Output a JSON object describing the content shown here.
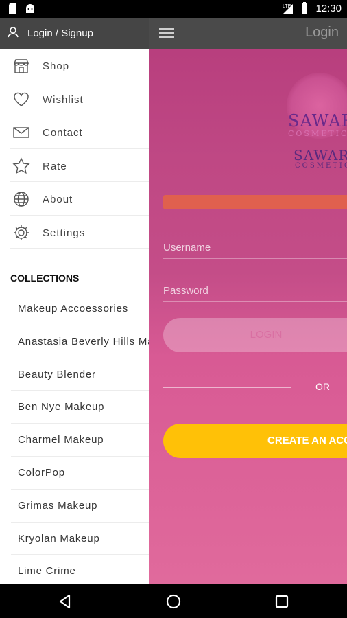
{
  "status_bar": {
    "time": "12:30",
    "network": "LTE"
  },
  "drawer": {
    "header_label": "Login / Signup",
    "menu": [
      {
        "label": "Shop",
        "icon": "shop-icon"
      },
      {
        "label": "Wishlist",
        "icon": "heart-icon"
      },
      {
        "label": "Contact",
        "icon": "mail-icon"
      },
      {
        "label": "Rate",
        "icon": "star-icon"
      },
      {
        "label": "About",
        "icon": "globe-icon"
      },
      {
        "label": "Settings",
        "icon": "gear-icon"
      }
    ],
    "collections_title": "COLLECTIONS",
    "collections": [
      "Makeup Accoessories",
      "Anastasia Beverly Hills Makeup",
      "Beauty Blender",
      "Ben Nye Makeup",
      "Charmel Makeup",
      "ColorPop",
      "Grimas Makeup",
      "Kryolan Makeup",
      "Lime Crime"
    ]
  },
  "main": {
    "title": "Login",
    "logo": {
      "line1": "SAWARY",
      "line2": "COSMETICS",
      "line3": "SAWARY",
      "line4": "COSMETICS"
    },
    "username_placeholder": "Username",
    "password_placeholder": "Password",
    "login_button": "LOGIN",
    "or_text": "OR",
    "create_button": "CREATE AN ACCOUNT"
  },
  "colors": {
    "accent_yellow": "#ffc107",
    "pink_bg": "#c44d88",
    "error_bar": "#e0604e",
    "drawer_header": "#454545"
  }
}
